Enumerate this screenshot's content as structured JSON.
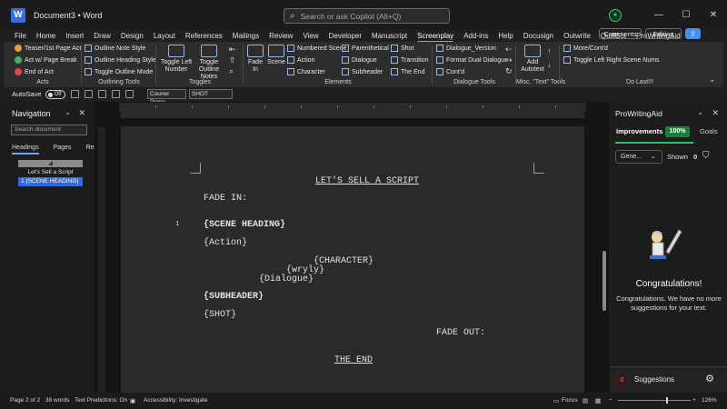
{
  "titlebar": {
    "app_letter": "W",
    "doc_title": "Document3  •  Word",
    "search_placeholder": "Search or ask Copilot (Alt+Q)",
    "minimize": "—",
    "maximize": "☐",
    "close": "✕"
  },
  "menu": {
    "tabs": [
      "File",
      "Home",
      "Insert",
      "Draw",
      "Design",
      "Layout",
      "References",
      "Mailings",
      "Review",
      "View",
      "Developer",
      "Manuscript",
      "Screenplay",
      "Add-ins",
      "Help",
      "Docusign",
      "Outwrite",
      "QuillBot",
      "ProWritingAid"
    ],
    "active": "Screenplay",
    "comments": "Comments",
    "editing": "Editing"
  },
  "ribbon": {
    "acts": {
      "items": [
        "Teaser/1st Page Act",
        "Act w/ Page Break",
        "End of Act"
      ],
      "label": "Acts"
    },
    "outlining": {
      "items": [
        "Outline Note Style",
        "Outline Heading Style",
        "Toggle Outline Mode"
      ],
      "label": "Outlining Tools"
    },
    "toggles": {
      "btn1": "Toggle Left Number",
      "btn2": "Toggle Outline Notes",
      "label": "Toggles"
    },
    "elements": {
      "fade_in": "Fade In",
      "scene": "Scene",
      "col1": [
        "Numbered Scene",
        "Action",
        "Character"
      ],
      "col2": [
        "Parenthetical",
        "Dialogue",
        "Subheader"
      ],
      "col3": [
        "Shot",
        "Transition",
        "The End"
      ],
      "label": "Elements"
    },
    "dialogue": {
      "items": [
        "Dialogue_Version",
        "Format Dual Dialogue",
        "Cont'd"
      ],
      "label": "Dialogue Tools"
    },
    "misc": {
      "btn": "Add Autotext",
      "label": "Misc. \"Text\" Tools"
    },
    "dolast": {
      "items": [
        "More/Cont'd",
        "Toggle Left Right Scene Nums"
      ],
      "label": "Do Last!!!"
    }
  },
  "qat": {
    "autosave": "AutoSave",
    "toggle_state": "Off",
    "font": "Courier Prime",
    "style": "SHOT"
  },
  "navigation": {
    "title": "Navigation",
    "search_placeholder": "Search document",
    "tabs": [
      "Headings",
      "Pages",
      "Results"
    ],
    "active_tab": "Headings",
    "collapse_glyph": "◢",
    "items": [
      "Let's Sell a Script",
      "1 {SCENE HEADING}"
    ]
  },
  "document": {
    "title": "LET'S SELL A SCRIPT",
    "fade_in": "FADE IN:",
    "scene_number": "1",
    "scene_heading": "{SCENE HEADING}",
    "action": "{Action}",
    "character": "{CHARACTER}",
    "parenthetical": "{wryly}",
    "dialogue": "{Dialogue}",
    "subheader": "{SUBHEADER}",
    "shot": "{SHOT}",
    "fade_out": "FADE OUT:",
    "the_end": "THE END"
  },
  "prowritingaid": {
    "title": "ProWritingAid",
    "tab_improvements": "Improvements",
    "percent": "100%",
    "tab_goals": "Goals",
    "filter": "Gene...",
    "shown_label": "Shown",
    "shown_count": "0",
    "congrats_title": "Congratulations!",
    "congrats_msg": "Congratulations. We have no more suggestions for your text.",
    "suggestions_count": "0",
    "suggestions_label": "Suggestions"
  },
  "status": {
    "page": "Page 2 of 2",
    "words": "38 words",
    "text_predictions": "Text Predictions: On",
    "accessibility": "Accessibility: Investigate",
    "focus": "Focus",
    "zoom": "126%"
  },
  "colors": {
    "accent": "#6fa3f4",
    "pwa_green": "#2dbf63",
    "nav_selected": "#2f6ad8"
  }
}
